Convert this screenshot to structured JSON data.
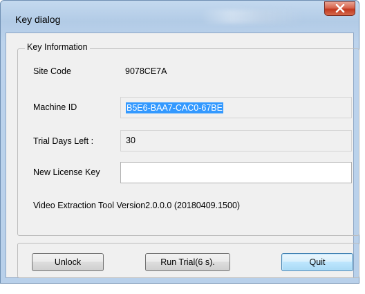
{
  "window": {
    "title": "Key dialog"
  },
  "group": {
    "title": "Key Information"
  },
  "fields": {
    "site_code_label": "Site Code",
    "site_code_value": "9078CE7A",
    "machine_id_label": "Machine ID",
    "machine_id_value": "B5E6-BAA7-CAC0-67BE",
    "trial_days_label": "Trial Days Left :",
    "trial_days_value": "30",
    "license_key_label": "New License Key",
    "license_key_value": ""
  },
  "version_text": "Video Extraction Tool Version2.0.0.0 (20180409.1500)",
  "buttons": {
    "unlock": "Unlock",
    "run_trial": "Run Trial(6 s).",
    "quit": "Quit"
  },
  "icons": {
    "close": "close-icon"
  },
  "colors": {
    "selection": "#3399ff",
    "close_button": "#c2391f",
    "title_bar": "#b2cbe6"
  }
}
